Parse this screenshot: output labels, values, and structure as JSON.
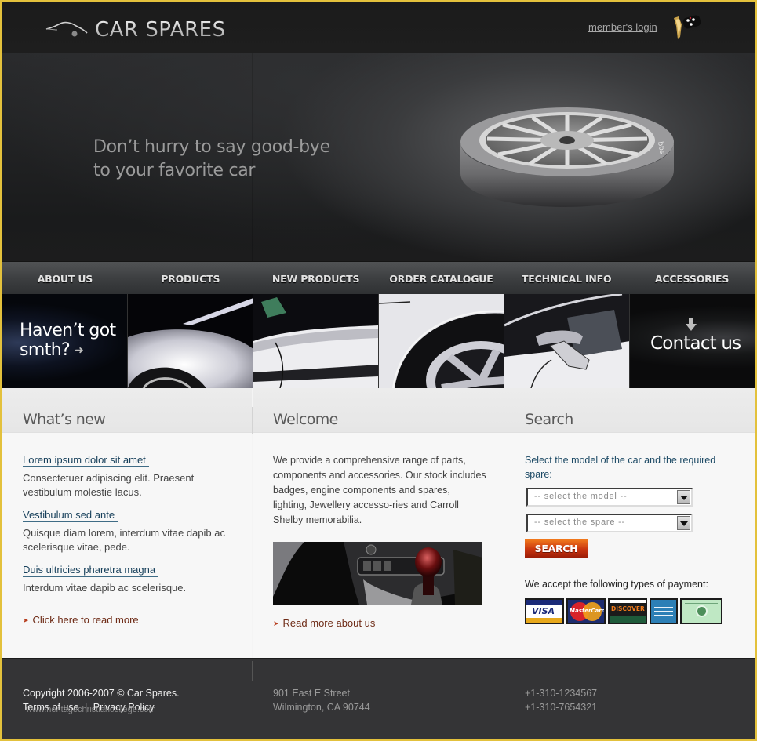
{
  "header": {
    "logo_text": "CAR SPARES",
    "login_label": "member's login",
    "logo_icon": "car-silhouette-icon",
    "login_icon": "car-keys-icon"
  },
  "hero": {
    "tagline_line1": "Don’t hurry to say good-bye",
    "tagline_line2": "to your favorite car",
    "image": "alloy-wheel-tire"
  },
  "nav": {
    "items": [
      {
        "label": "ABOUT US"
      },
      {
        "label": "PRODUCTS"
      },
      {
        "label": "NEW PRODUCTS"
      },
      {
        "label": "ORDER CATALOGUE"
      },
      {
        "label": "TECHNICAL INFO"
      },
      {
        "label": "ACCESSORIES"
      }
    ]
  },
  "strip": {
    "left_promo_line1": "Haven’t got",
    "left_promo_line2": "smth?",
    "left_arrow": "➜",
    "right_promo": "Contact us",
    "tiles": [
      "car-front-fender",
      "car-door-window",
      "car-wheel-arch",
      "car-side-mirror"
    ]
  },
  "whats_new": {
    "title": "What’s new",
    "items": [
      {
        "title": "Lorem ipsum dolor sit amet",
        "text": "Consectetuer adipiscing elit. Praesent vestibulum molestie lacus."
      },
      {
        "title": "Vestibulum sed ante",
        "text": "Quisque diam lorem, interdum vitae dapib ac scelerisque vitae, pede."
      },
      {
        "title": "Duis ultricies pharetra magna",
        "text": "Interdum vitae dapib ac scelerisque."
      }
    ],
    "more_label": "Click here to read more"
  },
  "welcome": {
    "title": "Welcome",
    "text": "We provide a comprehensive range of parts, components and accessories.  Our stock includes badges, engine components and spares, lighting, Jewellery accesso-ries and Carroll Shelby memorabilia.",
    "image": "gear-shift-interior",
    "more_label": "Read more about us"
  },
  "search": {
    "title": "Search",
    "intro": "Select the model of the car and the required spare:",
    "model_select": "-- select the model --",
    "spare_select": "-- select the spare --",
    "button_label": "SEARCH",
    "payment_label": "We accept the following types of payment:",
    "payment_cards": [
      {
        "name": "VISA",
        "icon": "visa-card-icon"
      },
      {
        "name": "MasterCard",
        "icon": "mastercard-icon"
      },
      {
        "name": "DISCOVER",
        "icon": "discover-card-icon"
      },
      {
        "name": "AMERICAN EXPRESS",
        "icon": "amex-card-icon"
      },
      {
        "name": "Cash",
        "icon": "cash-icon"
      }
    ]
  },
  "footer": {
    "copyright": "Copyright 2006-2007 © Car Spares.",
    "terms_label": "Terms of use",
    "divider": "|",
    "privacy_label": "Privacy Policy",
    "watermark": "www.heritagechristiancollege.com",
    "address_line1": "901 East E Street",
    "address_line2": "Wilmington, CA 90744",
    "phone1": "+1-310-1234567",
    "phone2": "+1-310-7654321"
  },
  "colors": {
    "frame": "#e3c13c",
    "link_blue": "#163f5a",
    "more_link": "#6e2b16",
    "search_button": "#c8350f",
    "footer_bg": "#343436"
  }
}
